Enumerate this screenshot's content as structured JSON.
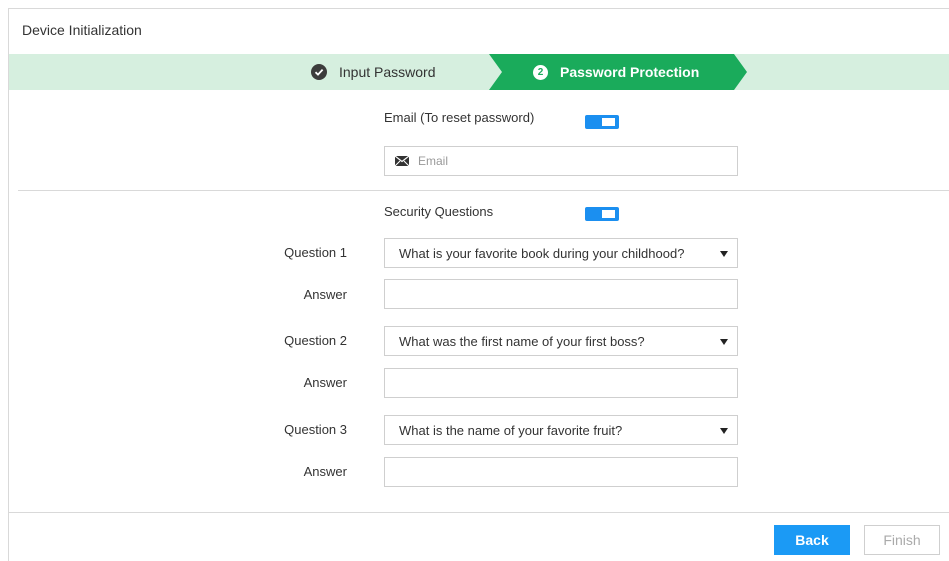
{
  "window": {
    "title": "Device Initialization"
  },
  "steps": [
    {
      "label": "Input Password",
      "state": "done"
    },
    {
      "number": "2",
      "label": "Password Protection",
      "state": "active"
    }
  ],
  "email": {
    "label": "Email (To reset password)",
    "toggle_on": true,
    "placeholder": "Email",
    "value": ""
  },
  "security": {
    "label": "Security Questions",
    "toggle_on": true,
    "questions": [
      {
        "label": "Question 1",
        "selected": "What is your favorite book during your childhood?",
        "answer_label": "Answer",
        "answer": ""
      },
      {
        "label": "Question 2",
        "selected": "What was the first name of your first boss?",
        "answer_label": "Answer",
        "answer": ""
      },
      {
        "label": "Question 3",
        "selected": "What is the name of your favorite fruit?",
        "answer_label": "Answer",
        "answer": ""
      }
    ]
  },
  "buttons": {
    "back": "Back",
    "finish": "Finish"
  },
  "colors": {
    "step_bar": "#d6efdf",
    "step_active": "#1aab5b",
    "toggle": "#1b8ff0",
    "primary_button": "#1b9af5"
  }
}
